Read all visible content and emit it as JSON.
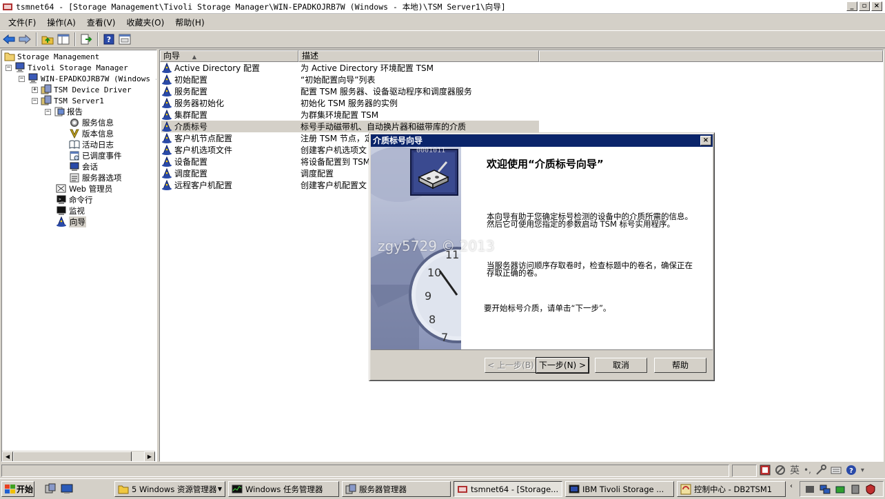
{
  "window": {
    "title": "tsmnet64 - [Storage Management\\Tivoli Storage Manager\\WIN-EPADKOJRB7W  (Windows - 本地)\\TSM Server1\\向导]",
    "controls": [
      "_",
      "▫",
      "×"
    ]
  },
  "menu": [
    "文件(F)",
    "操作(A)",
    "查看(V)",
    "收藏夹(O)",
    "帮助(H)"
  ],
  "tree": {
    "root": "Storage Management",
    "tsm": "Tivoli Storage Manager",
    "machine": "WIN-EPADKOJRB7W  (Windows -",
    "device_driver": "TSM Device Driver",
    "server": "TSM Server1",
    "reports": "报告",
    "service_info": "服务信息",
    "version_info": "版本信息",
    "activity_log": "活动日志",
    "scheduled_events": "已调度事件",
    "sessions": "会话",
    "server_options": "服务器选项",
    "web_admin": "Web 管理员",
    "command_line": "命令行",
    "monitor": "监视",
    "wizards": "向导"
  },
  "list": {
    "columns": [
      "向导",
      "描述"
    ],
    "sort_indicator": "▲",
    "rows": [
      {
        "name": "Active Directory 配置",
        "desc": "为 Active Directory 环境配置 TSM"
      },
      {
        "name": "初始配置",
        "desc": "“初始配置向导”列表"
      },
      {
        "name": "服务配置",
        "desc": "配置 TSM 服务器、设备驱动程序和调度器服务"
      },
      {
        "name": "服务器初始化",
        "desc": "初始化 TSM 服务器的实例"
      },
      {
        "name": "集群配置",
        "desc": "为群集环境配置 TSM"
      },
      {
        "name": "介质标号",
        "desc": "标号手动磁带机、自动换片器和磁带库的介质"
      },
      {
        "name": "客户机节点配置",
        "desc": "注册 TSM 节点，定"
      },
      {
        "name": "客户机选项文件",
        "desc": "创建客户机选项文"
      },
      {
        "name": "设备配置",
        "desc": "将设备配置到 TSM"
      },
      {
        "name": "调度配置",
        "desc": "调度配置"
      },
      {
        "name": "远程客户机配置",
        "desc": "创建客户机配置文"
      }
    ]
  },
  "dialog": {
    "title": "介质标号向导",
    "close": "×",
    "heading": "欢迎使用“介质标号向导”",
    "p1": "本向导有助于您确定标号检测的设备中的介质所需的信息。然后它可使用您指定的参数启动 TSM 标号实用程序。",
    "p2": "当服务器访问顺序存取卷时，检查标题中的卷名，确保正在存取正确的卷。",
    "p3": "要开始标号介质，请单击“下一步”。",
    "binary_text": "0001011",
    "back": "< 上一步(B)",
    "next": "下一步(N) >",
    "cancel": "取消",
    "help": "帮助"
  },
  "watermark": "zgy5729 © 2013",
  "statusbar": {
    "ime": "英"
  },
  "taskbar": {
    "start": "开始",
    "items": [
      "5 Windows 资源管理器",
      "Windows 任务管理器",
      "服务器管理器",
      "tsmnet64 - [Storage...",
      "IBM Tivoli Storage ...",
      "控制中心 - DB2TSM1"
    ]
  }
}
